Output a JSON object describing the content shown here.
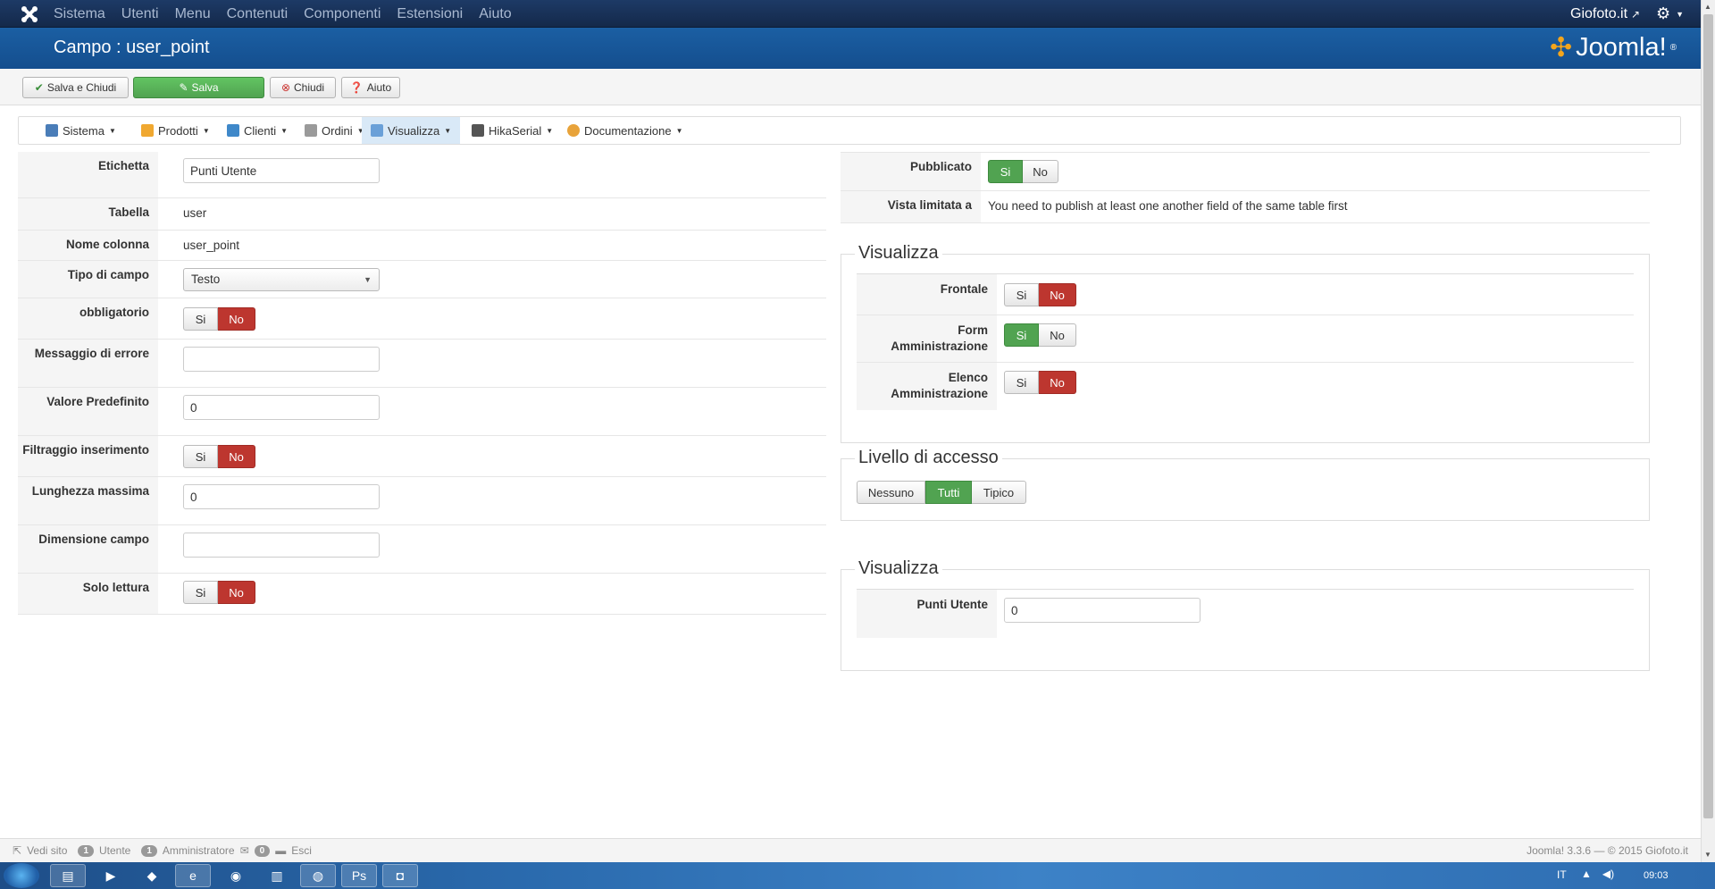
{
  "topbar": {
    "menu": [
      "Sistema",
      "Utenti",
      "Menu",
      "Contenuti",
      "Componenti",
      "Estensioni",
      "Aiuto"
    ],
    "site_link": "Giofoto.it"
  },
  "titlebar": {
    "title": "Campo : user_point",
    "logo_text": "Joomla!",
    "logo_reg": "®"
  },
  "toolbar": {
    "save_close": "Salva e Chiudi",
    "save": "Salva",
    "close": "Chiudi",
    "help": "Aiuto"
  },
  "submenu": [
    "Sistema",
    "Prodotti",
    "Clienti",
    "Ordini",
    "Visualizza",
    "HikaSerial",
    "Documentazione"
  ],
  "toggle": {
    "yes": "Si",
    "no": "No"
  },
  "left_form": {
    "etichetta_label": "Etichetta",
    "etichetta_value": "Punti Utente",
    "tabella_label": "Tabella",
    "tabella_value": "user",
    "colonna_label": "Nome colonna",
    "colonna_value": "user_point",
    "tipo_label": "Tipo di campo",
    "tipo_value": "Testo",
    "obbligatorio_label": "obbligatorio",
    "errore_label": "Messaggio di errore",
    "errore_value": "",
    "predefinito_label": "Valore Predefinito",
    "predefinito_value": "0",
    "filtraggio_label": "Filtraggio inserimento",
    "lunghezza_label": "Lunghezza massima",
    "lunghezza_value": "0",
    "dimensione_label": "Dimensione campo",
    "dimensione_value": "",
    "sola_label": "Solo lettura"
  },
  "right_panel": {
    "pubblicato_label": "Pubblicato",
    "vista_label": "Vista limitata a",
    "vista_value": "You need to publish at least one another field of the same table first",
    "visualizza_legend": "Visualizza",
    "frontale_label": "Frontale",
    "form_admin_label_1": "Form",
    "form_admin_label_2": "Amministrazione",
    "elenco_admin_label_1": "Elenco",
    "elenco_admin_label_2": "Amministrazione",
    "accesso_legend": "Livello di accesso",
    "accesso_options": [
      "Nessuno",
      "Tutti",
      "Tipico"
    ],
    "visualizza2_legend": "Visualizza",
    "punti_label": "Punti Utente",
    "punti_value": "0"
  },
  "statusbar": {
    "vedi_sito": "Vedi sito",
    "utente_count": "1",
    "utente_label": "Utente",
    "admin_count": "1",
    "admin_label": "Amministratore",
    "msg_count": "0",
    "esci": "Esci",
    "version": "Joomla! 3.3.6 — © 2015 Giofoto.it"
  },
  "taskbar": {
    "lang": "IT",
    "clock": "09:03"
  },
  "colors": {
    "topbar": "#14294a",
    "titlebar": "#1b5fa3",
    "toggle_no_active": "#bd362f",
    "toggle_yes_active": "#51a351"
  }
}
